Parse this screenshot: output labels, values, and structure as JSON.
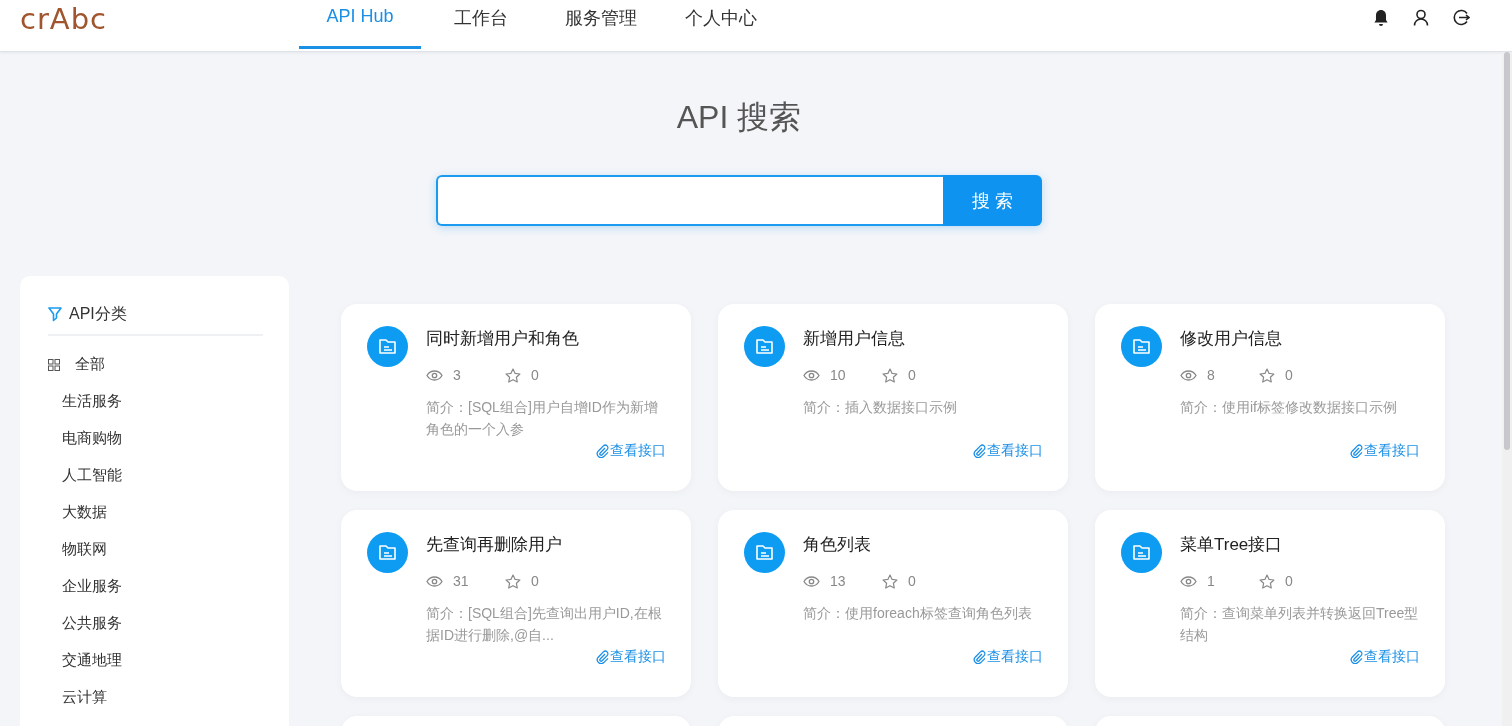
{
  "header": {
    "logo": "crAbc",
    "tabs": [
      {
        "label": "API Hub",
        "selected": true
      },
      {
        "label": "工作台",
        "selected": false
      },
      {
        "label": "服务管理",
        "selected": false
      },
      {
        "label": "个人中心",
        "selected": false
      }
    ]
  },
  "search": {
    "title": "API 搜索",
    "button": "搜 索"
  },
  "sidebar": {
    "title": "API分类",
    "items": [
      {
        "label": "全部",
        "kind": "all"
      },
      {
        "label": "生活服务",
        "kind": "category"
      },
      {
        "label": "电商购物",
        "kind": "category"
      },
      {
        "label": "人工智能",
        "kind": "category"
      },
      {
        "label": "大数据",
        "kind": "category"
      },
      {
        "label": "物联网",
        "kind": "category"
      },
      {
        "label": "企业服务",
        "kind": "category"
      },
      {
        "label": "公共服务",
        "kind": "category"
      },
      {
        "label": "交通地理",
        "kind": "category"
      },
      {
        "label": "云计算",
        "kind": "category"
      }
    ]
  },
  "cards": [
    {
      "title": "同时新增用户和角色",
      "views": "3",
      "stars": "0",
      "description": "简介：[SQL组合]用户自增ID作为新增角色的一个入参",
      "link": "查看接口"
    },
    {
      "title": "新增用户信息",
      "views": "10",
      "stars": "0",
      "description": "简介：插入数据接口示例",
      "link": "查看接口"
    },
    {
      "title": "修改用户信息",
      "views": "8",
      "stars": "0",
      "description": "简介：使用if标签修改数据接口示例",
      "link": "查看接口"
    },
    {
      "title": "先查询再删除用户",
      "views": "31",
      "stars": "0",
      "description": "简介：[SQL组合]先查询出用户ID,在根据ID进行删除,@自...",
      "link": "查看接口"
    },
    {
      "title": "角色列表",
      "views": "13",
      "stars": "0",
      "description": "简介：使用foreach标签查询角色列表",
      "link": "查看接口"
    },
    {
      "title": "菜单Tree接口",
      "views": "1",
      "stars": "0",
      "description": "简介：查询菜单列表并转换返回Tree型结构",
      "link": "查看接口"
    }
  ]
}
